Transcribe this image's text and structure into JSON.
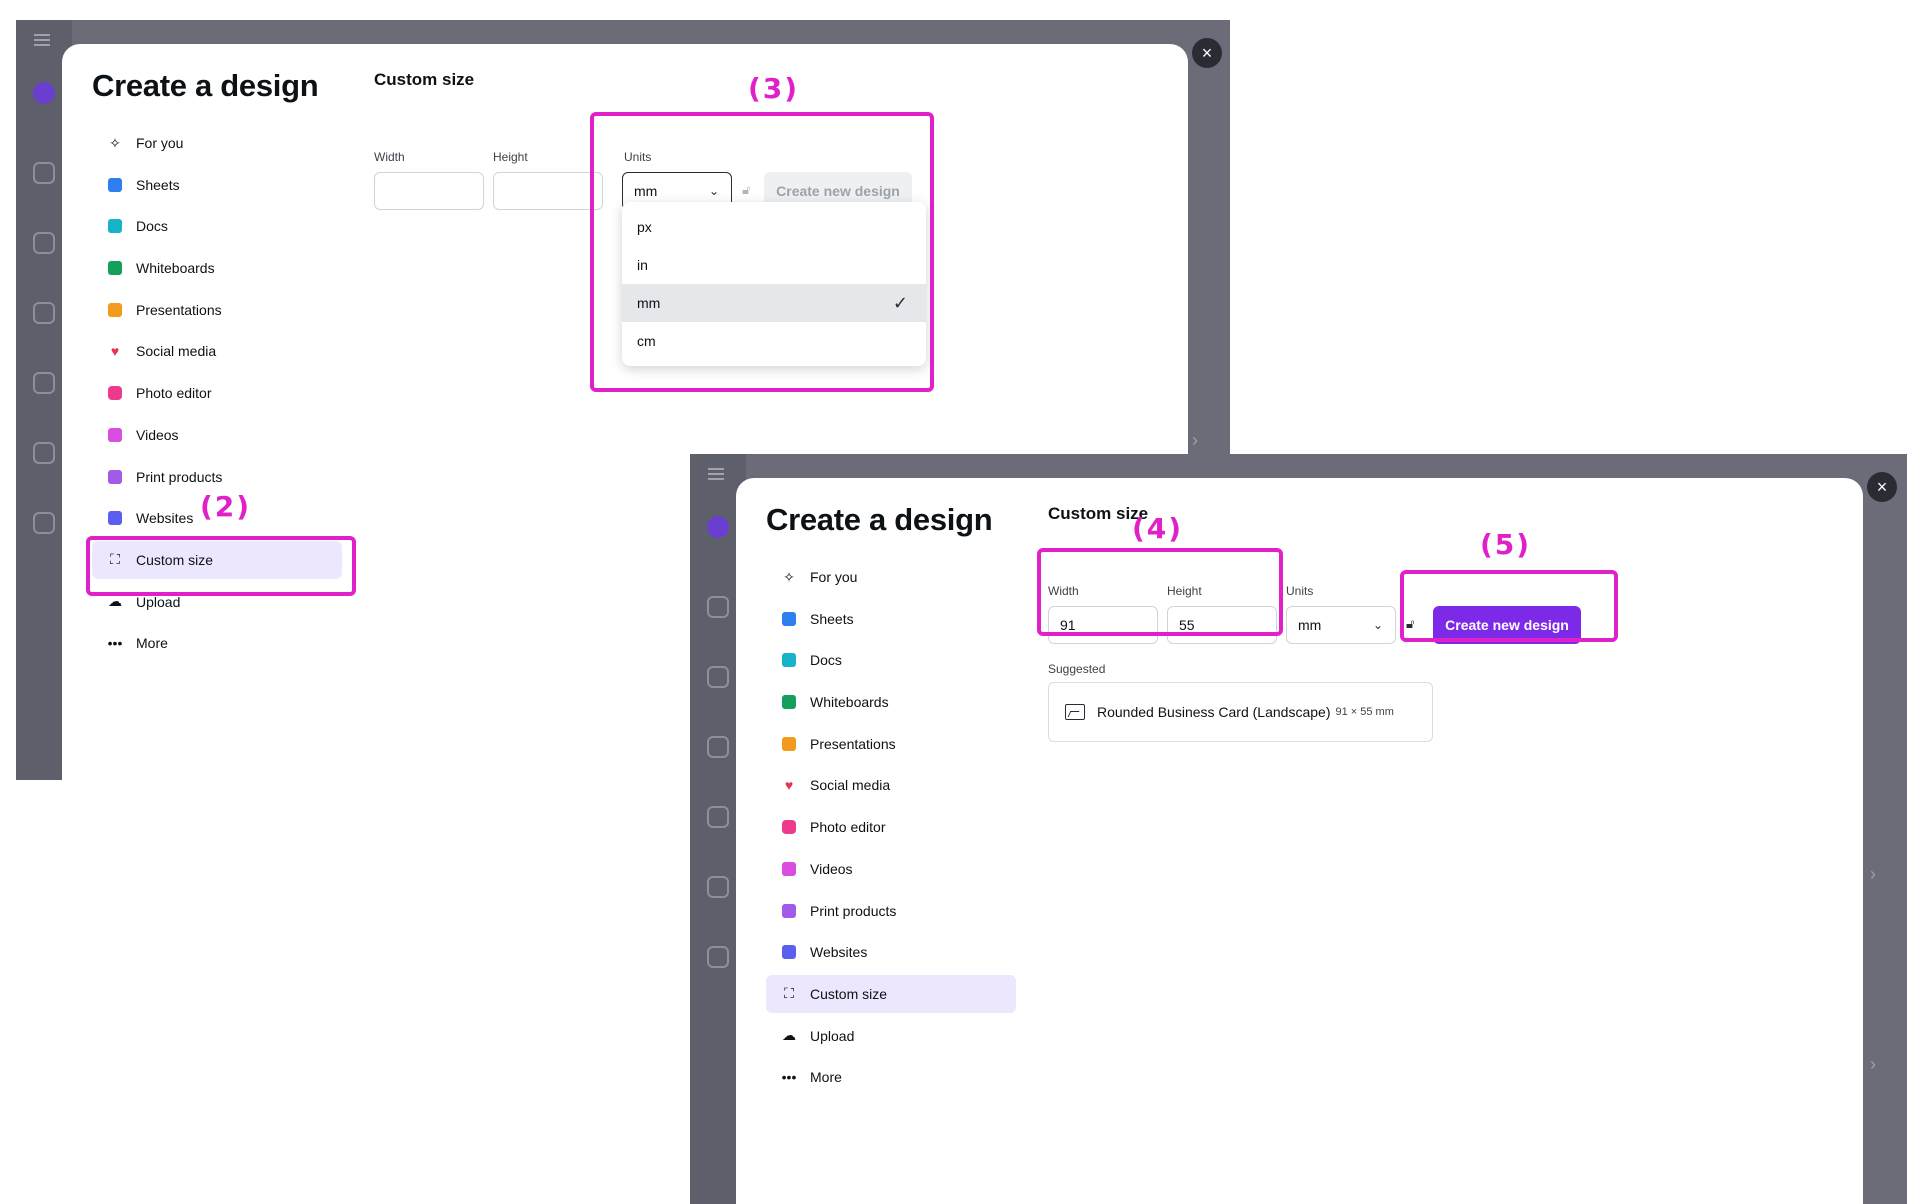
{
  "dialog": {
    "title": "Create a design",
    "close_icon": "×",
    "menu": [
      {
        "label": "For you",
        "icon": "sparkle-icon"
      },
      {
        "label": "Sheets",
        "icon": "sheets-icon"
      },
      {
        "label": "Docs",
        "icon": "docs-icon"
      },
      {
        "label": "Whiteboards",
        "icon": "whiteboards-icon"
      },
      {
        "label": "Presentations",
        "icon": "presentations-icon"
      },
      {
        "label": "Social media",
        "icon": "heart-icon"
      },
      {
        "label": "Photo editor",
        "icon": "camera-icon"
      },
      {
        "label": "Videos",
        "icon": "video-icon"
      },
      {
        "label": "Print products",
        "icon": "print-icon"
      },
      {
        "label": "Websites",
        "icon": "website-icon"
      },
      {
        "label": "Custom size",
        "icon": "custom-size-icon"
      },
      {
        "label": "Upload",
        "icon": "upload-cloud-icon"
      },
      {
        "label": "More",
        "icon": "more-dots-icon"
      }
    ],
    "custom_size": {
      "title": "Custom size",
      "width_label": "Width",
      "height_label": "Height",
      "units_label": "Units",
      "create_button": "Create new design"
    }
  },
  "screen1": {
    "width_value": "",
    "height_value": "",
    "units_value": "mm",
    "units_options": [
      "px",
      "in",
      "mm",
      "cm"
    ],
    "selected_option": "mm"
  },
  "screen2": {
    "width_value": "91",
    "height_value": "55",
    "units_value": "mm",
    "suggested_label": "Suggested",
    "suggestion_name": "Rounded Business Card (Landscape)",
    "suggestion_dims": "91 × 55 mm"
  },
  "annotations": {
    "step2": "(2)",
    "step3": "(3)",
    "step4": "(4)",
    "step5": "(5)"
  },
  "colors": {
    "highlight": "#e020c8",
    "primary_button": "#7d2ae8",
    "active_menu_bg": "#ede7fd"
  }
}
